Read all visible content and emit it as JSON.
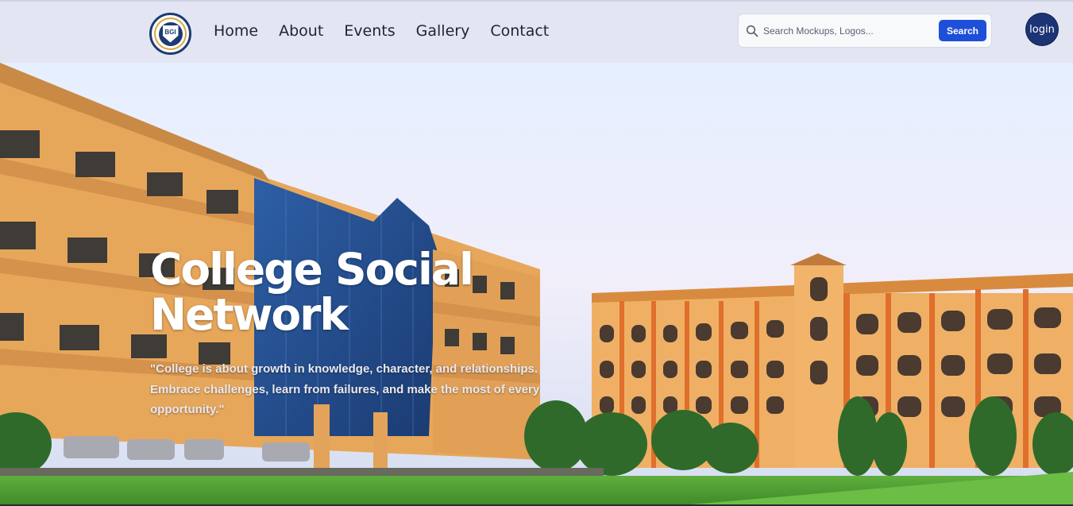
{
  "header": {
    "logo_text": "BGI",
    "nav": [
      "Home",
      "About",
      "Events",
      "Gallery",
      "Contact"
    ],
    "search": {
      "placeholder": "Search Mockups, Logos...",
      "button_label": "Search"
    },
    "login_label": "login"
  },
  "hero": {
    "title": "College Social Network",
    "quote": "\"College is about growth in knowledge, character, and relationships. Embrace challenges, learn from failures, and make the most of every opportunity.\""
  },
  "colors": {
    "header_bg": "#e3e5f3",
    "search_button": "#1d4fd8",
    "login_button": "#1c3476",
    "building": "#e8a95e",
    "glass": "#274f8f"
  },
  "icons": {
    "logo": "college-crest-icon",
    "search": "search-icon"
  }
}
